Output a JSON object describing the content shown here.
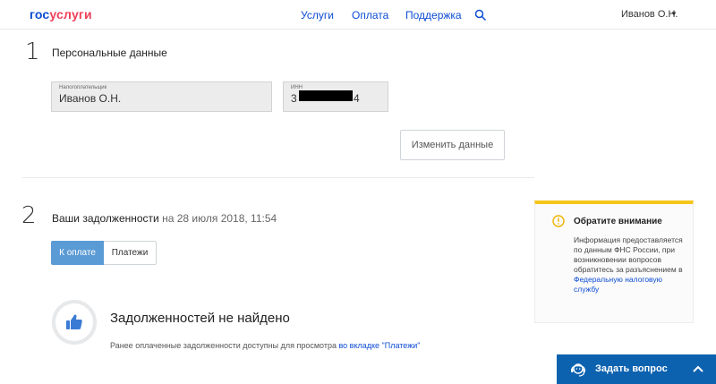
{
  "header": {
    "logo_part1": "гос",
    "logo_part2": "услуги",
    "nav": [
      "Услуги",
      "Оплата",
      "Поддержка"
    ],
    "search_icon": "search-icon",
    "user_name": "Иванов О.Н.",
    "user_caret": "▼"
  },
  "step1": {
    "number": "1",
    "title": "Персональные данные",
    "taxpayer_label": "Налогоплательщик",
    "taxpayer_value": "Иванов О.Н.",
    "inn_label": "ИНН",
    "inn_first": "3",
    "inn_last": "4",
    "edit_button": "Изменить данные"
  },
  "step2": {
    "number": "2",
    "title": "Ваши задолженности",
    "date": " на 28 июля 2018, 11:54",
    "tab_pay": "К оплате",
    "tab_payments": "Платежи",
    "empty_title": "Задолженностей не найдено",
    "empty_note": "Ранее оплаченные задолженности доступны для просмотра ",
    "empty_link": "во вкладке \"Платежи\""
  },
  "notice": {
    "title": "Обратите внимание",
    "text": "Информация предоставляется по данным ФНС России, при возникновении вопросов обратитесь за разъяснением в ",
    "link": "Федеральную налоговую службу",
    "accent": "#f5c518"
  },
  "ask": {
    "label": "Задать вопрос",
    "icon": "operator-icon"
  },
  "colors": {
    "brand_blue": "#0d4cd3",
    "brand_red": "#ee3f58",
    "tab_active": "#5b9bd5",
    "ask_bg": "#0d62b0"
  }
}
